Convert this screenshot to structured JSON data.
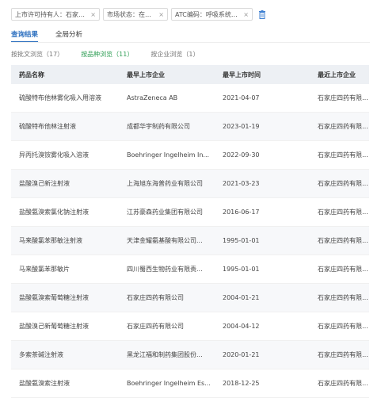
{
  "filters": [
    {
      "label": "上市许可持有人：石家庄...",
      "close": "×"
    },
    {
      "label": "市场状态：在使用",
      "close": "×"
    },
    {
      "label": "ATC编码：呼吸系统用药",
      "close": "×"
    }
  ],
  "tabs": [
    "查询结果",
    "全局分析"
  ],
  "subtabs": [
    "按批文浏览（17）",
    "按品种浏览（11）",
    "按企业浏览（1）"
  ],
  "table": {
    "headers": [
      "药品名称",
      "最早上市企业",
      "最早上市时间",
      "最近上市企业"
    ],
    "rows": [
      [
        "硫酸特布他林雾化吸入用溶液",
        "AstraZeneca AB",
        "2021-04-07",
        "石家庄四药有限公司"
      ],
      [
        "硫酸特布他林注射液",
        "成都华宇制药有限公司",
        "2023-01-19",
        "石家庄四药有限公司"
      ],
      [
        "异丙托溴铵雾化吸入溶液",
        "Boehringer Ingelheim In...",
        "2022-09-30",
        "石家庄四药有限公司"
      ],
      [
        "盐酸溴己新注射液",
        "上海旭东海普药业有限公司",
        "2021-03-23",
        "石家庄四药有限公司"
      ],
      [
        "盐酸氨溴索氯化钠注射液",
        "江苏豪森药业集团有限公司",
        "2016-06-17",
        "石家庄四药有限公司"
      ],
      [
        "马来酸氯苯那敏注射液",
        "天津金耀氨基酸有限公司...",
        "1995-01-01",
        "石家庄四药有限公司"
      ],
      [
        "马来酸氯苯那敏片",
        "四川蜀西生物药业有限责...",
        "1995-01-01",
        "石家庄四药有限公司"
      ],
      [
        "盐酸氨溴索葡萄糖注射液",
        "石家庄四药有限公司",
        "2004-01-21",
        "石家庄四药有限公司"
      ],
      [
        "盐酸溴己新葡萄糖注射液",
        "石家庄四药有限公司",
        "2004-04-12",
        "石家庄四药有限公司"
      ],
      [
        "多索茶碱注射液",
        "黑龙江福和制药集团股份...",
        "2020-01-21",
        "石家庄四药有限公司"
      ],
      [
        "盐酸氨溴索注射液",
        "Boehringer Ingelheim Es...",
        "2018-12-25",
        "石家庄四药有限公司"
      ]
    ]
  }
}
